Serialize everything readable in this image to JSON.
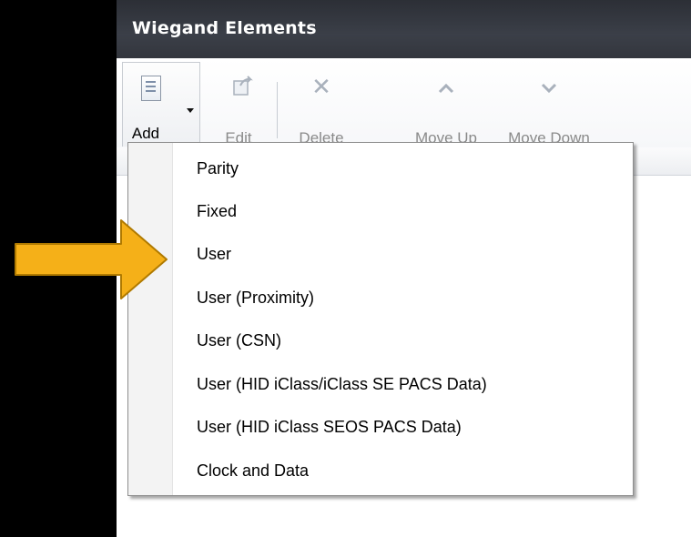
{
  "window": {
    "title": "Wiegand Elements"
  },
  "toolbar": {
    "add": {
      "label": "Add",
      "icon": "add-document-icon"
    },
    "edit": {
      "label": "Edit",
      "icon": "edit-document-icon"
    },
    "delete": {
      "label": "Delete",
      "icon": "delete-x-icon"
    },
    "move_up": {
      "label": "Move Up",
      "icon": "chevron-up-icon"
    },
    "move_down": {
      "label": "Move Down",
      "icon": "chevron-down-icon"
    }
  },
  "add_menu": {
    "items": [
      {
        "label": "Parity"
      },
      {
        "label": "Fixed"
      },
      {
        "label": "User"
      },
      {
        "label": "User (Proximity)"
      },
      {
        "label": "User (CSN)"
      },
      {
        "label": "User (HID iClass/iClass SE PACS Data)"
      },
      {
        "label": "User (HID iClass SEOS PACS Data)"
      },
      {
        "label": "Clock and Data"
      }
    ]
  },
  "callout": {
    "icon": "arrow-right-icon",
    "color": "#F5B018",
    "points_to": "User"
  },
  "colors": {
    "titlebar": "#33363d",
    "background": "#000000",
    "accent_arrow": "#F5B018"
  }
}
